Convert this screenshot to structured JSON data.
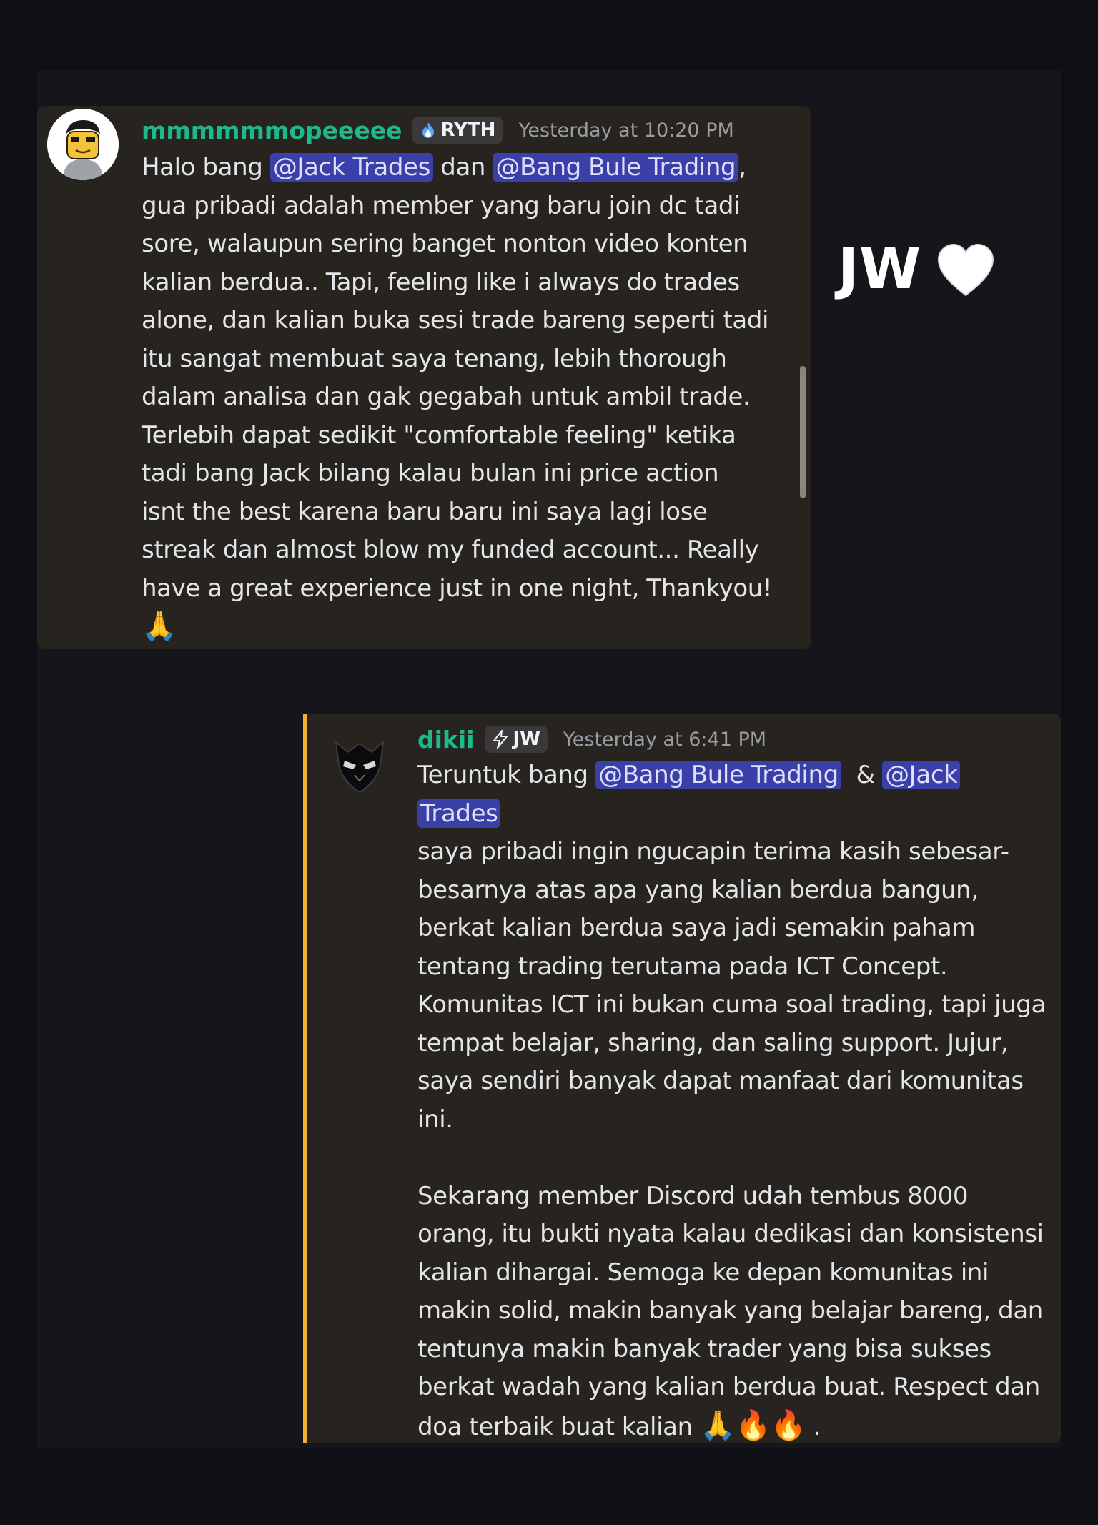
{
  "overlay": {
    "label": "JW",
    "heart_icon": "white-heart-icon",
    "heart_color": "#ffffff"
  },
  "message1": {
    "username": "mmmmmmopeeeee",
    "username_color": "#1db98b",
    "tag": "RYTH",
    "tag_icon": "flame-badge-icon",
    "timestamp": "Yesterday at 10:20 PM",
    "avatar_icon": "cartoon-face-avatar",
    "lines": {
      "l1_a": "Halo bang ",
      "l1_mention1": "@Jack Trades",
      "l1_b": " dan ",
      "l1_mention2": "@Bang Bule Trading",
      "l1_c": ",",
      "l2": "gua pribadi adalah member yang baru join dc tadi",
      "l3": "sore, walaupun sering banget nonton video konten",
      "l4": "kalian berdua.. Tapi, feeling like i always do trades",
      "l5": "alone, dan kalian buka sesi trade bareng seperti tadi",
      "l6": "itu sangat membuat saya tenang, lebih thorough",
      "l7": "dalam analisa dan gak gegabah untuk ambil trade.",
      "l8": "Terlebih dapat sedikit \"comfortable feeling\" ketika",
      "l9": "tadi bang Jack bilang kalau bulan ini price action",
      "l10": "isnt the best karena baru baru ini saya lagi lose",
      "l11": "streak dan almost blow my funded account... Really",
      "l12": "have a great experience just in one night, Thankyou!",
      "l13": "🙏"
    }
  },
  "message2": {
    "username": "dikii",
    "username_color": "#1db98b",
    "tag": "JW",
    "tag_icon": "lightning-icon",
    "timestamp": "Yesterday at 6:41 PM",
    "avatar_icon": "black-mask-avatar",
    "accent_color": "#f0b232",
    "lines": {
      "l1_a": "Teruntuk bang ",
      "l1_mention1": "@Bang Bule Trading",
      "l1_b": "  & ",
      "l1_mention2a": "@Jack",
      "l2_mention2b": "Trades",
      "l3": "saya pribadi ingin ngucapin terima kasih sebesar-",
      "l4": "besarnya atas apa yang kalian berdua bangun,",
      "l5": "berkat kalian berdua saya jadi semakin paham",
      "l6": "tentang trading terutama pada ICT Concept.",
      "l7": "Komunitas ICT ini bukan cuma soal trading, tapi juga",
      "l8": "tempat belajar, sharing, dan saling support. Jujur,",
      "l9": "saya sendiri banyak dapat manfaat dari komunitas",
      "l10": "ini.",
      "l12": "Sekarang member Discord udah tembus 8000",
      "l13": "orang, itu bukti nyata kalau dedikasi dan konsistensi",
      "l14": "kalian dihargai. Semoga ke depan komunitas ini",
      "l15": "makin solid, makin banyak yang belajar bareng, dan",
      "l16": "tentunya makin banyak trader yang bisa sukses",
      "l17": "berkat wadah yang kalian berdua buat. Respect dan",
      "l18_a": "doa terbaik buat kalian ",
      "l18_emoji": "🙏🔥🔥",
      "l18_b": " ."
    }
  }
}
